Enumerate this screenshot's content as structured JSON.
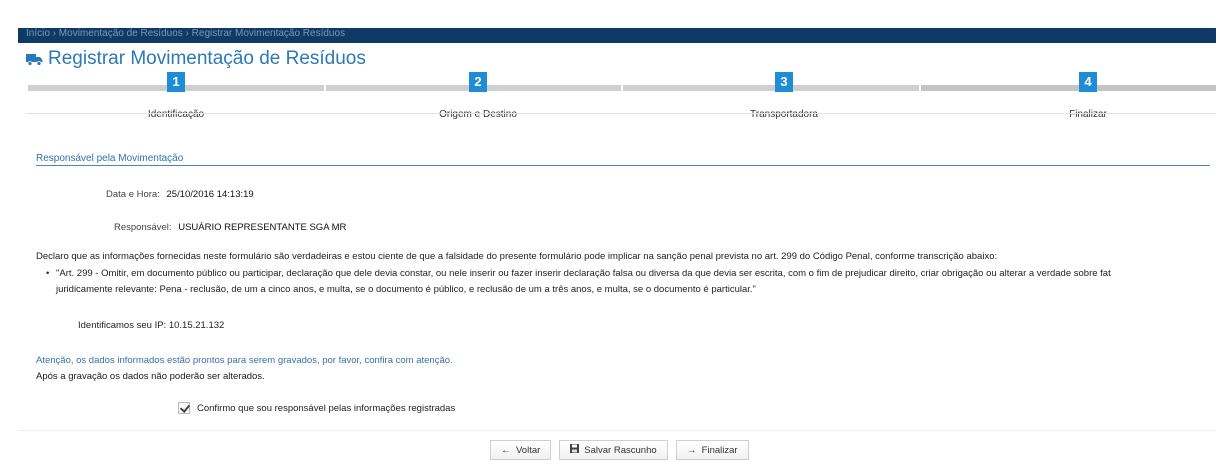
{
  "breadcrumb": {
    "home": "Início",
    "section": "Movimentação de Resíduos",
    "current": "Registrar Movimentação Resíduos"
  },
  "page": {
    "title": "Registrar Movimentação de Resíduos",
    "title_icon": "truck-icon"
  },
  "wizard": {
    "steps": [
      {
        "number": "1",
        "label": "Identificação"
      },
      {
        "number": "2",
        "label": "Origem e Destino"
      },
      {
        "number": "3",
        "label": "Transportadora"
      },
      {
        "number": "4",
        "label": "Finalizar"
      }
    ],
    "active_step": 4
  },
  "section": {
    "title": "Responsável pela Movimentação"
  },
  "fields": {
    "datetime_label": "Data e Hora:",
    "datetime_value": "25/10/2016 14:13:19",
    "responsible_label": "Responsável:",
    "responsible_value": "USUÁRIO REPRESENTANTE SGA MR"
  },
  "declaration": {
    "intro": "Declaro que as informações fornecidas neste formulário são verdadeiras e estou ciente de que a falsidade do presente formulário pode implicar na sanção penal prevista no art. 299 do Código Penal, conforme transcrição abaixo:",
    "quote_line1": "\"Art. 299 - Omitir, em documento público ou participar, declaração que dele devia constar, ou nele inserir ou fazer inserir declaração falsa ou diversa da que devia ser escrita, com o fim de prejudicar direito, criar obrigação ou alterar a verdade sobre fat",
    "quote_line2": "juridicamente relevante: Pena - reclusão, de um a cinco anos, e multa, se o documento é público, e reclusão de um a três anos, e multa, se o documento é particular.\""
  },
  "ip": {
    "label": "Identificamos seu IP:",
    "value": "10.15.21.132"
  },
  "attention": {
    "line1": "Atenção, os dados informados estão prontos para serem gravados, por favor, confira com atenção.",
    "line2": "Após a gravação os dados não poderão ser alterados."
  },
  "confirm": {
    "checked": true,
    "label": "Confirmo que sou responsável pelas informações registradas"
  },
  "buttons": {
    "back": "Voltar",
    "save_draft": "Salvar Rascunho",
    "finish": "Finalizar"
  },
  "colors": {
    "navbar": "#0f3a66",
    "accent": "#1f8dd6",
    "title": "#2a7ab8"
  }
}
